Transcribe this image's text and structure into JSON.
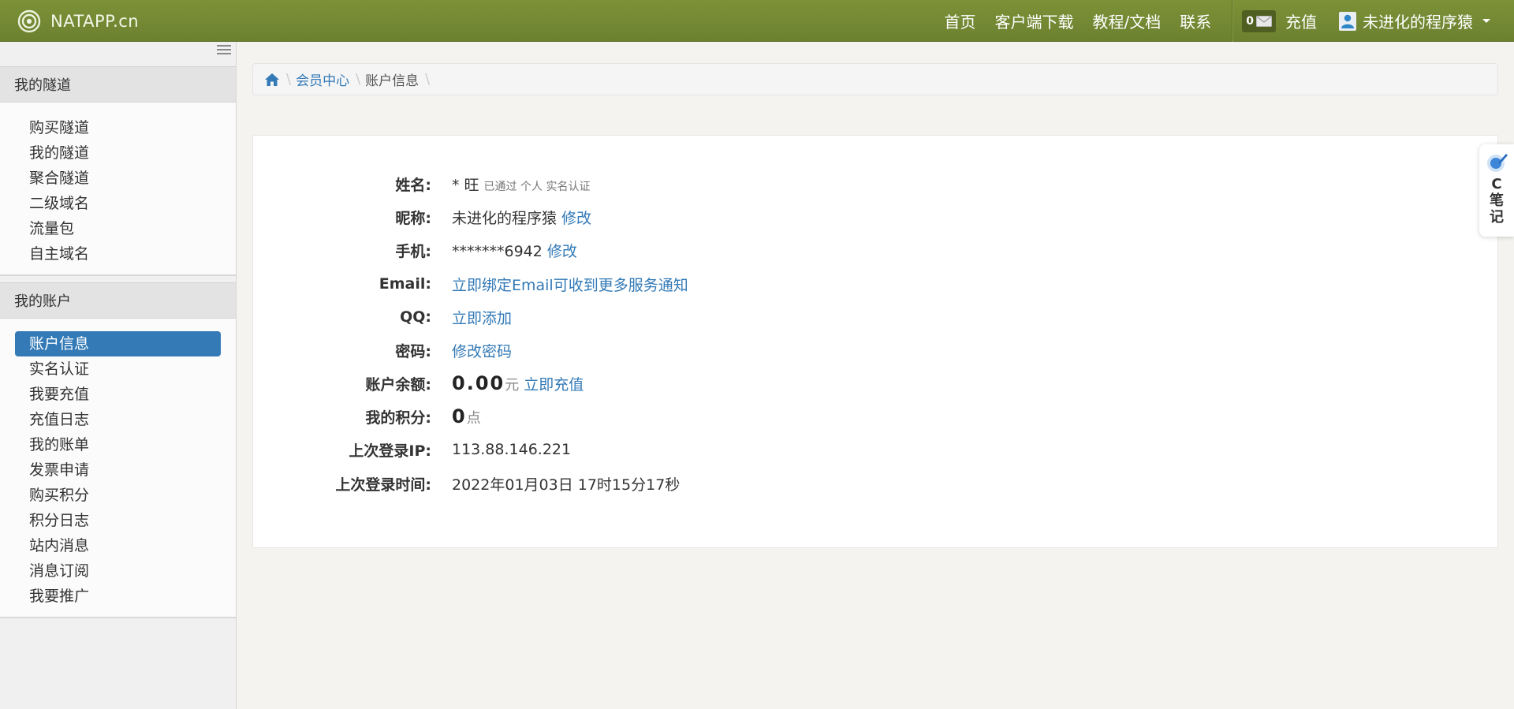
{
  "navbar": {
    "brand": "NATAPP.cn",
    "links": [
      "首页",
      "客户端下载",
      "教程/文档",
      "联系"
    ],
    "message_count": "0",
    "recharge": "充值",
    "username": "未进化的程序猿"
  },
  "sidebar": {
    "sections": [
      {
        "title": "我的隧道",
        "items": [
          "购买隧道",
          "我的隧道",
          "聚合隧道",
          "二级域名",
          "流量包",
          "自主域名"
        ]
      },
      {
        "title": "我的账户",
        "items": [
          "账户信息",
          "实名认证",
          "我要充值",
          "充值日志",
          "我的账单",
          "发票申请",
          "购买积分",
          "积分日志",
          "站内消息",
          "消息订阅",
          "我要推广"
        ]
      }
    ],
    "active_item": "账户信息"
  },
  "breadcrumb": {
    "member_center": "会员中心",
    "current": "账户信息"
  },
  "account": {
    "name": {
      "label": "姓名:",
      "value": "* 旺",
      "verify_note": "已通过 个人 实名认证"
    },
    "nickname": {
      "label": "昵称:",
      "value": "未进化的程序猿",
      "edit": "修改"
    },
    "phone": {
      "label": "手机:",
      "value": "*******6942",
      "edit": "修改"
    },
    "email": {
      "label": "Email:",
      "action": "立即绑定Email可收到更多服务通知"
    },
    "qq": {
      "label": "QQ:",
      "action": "立即添加"
    },
    "password": {
      "label": "密码:",
      "action": "修改密码"
    },
    "balance": {
      "label": "账户余额:",
      "value": "0.00",
      "unit": "元",
      "action": "立即充值"
    },
    "points": {
      "label": "我的积分:",
      "value": "0",
      "unit": "点"
    },
    "last_ip": {
      "label": "上次登录IP:",
      "value": "113.88.146.221"
    },
    "last_time": {
      "label": "上次登录时间:",
      "value": "2022年01月03日 17时15分17秒"
    }
  },
  "float_widget": {
    "text": "C笔记"
  },
  "colors": {
    "navbar": "#748a33",
    "accent": "#337ab7"
  }
}
